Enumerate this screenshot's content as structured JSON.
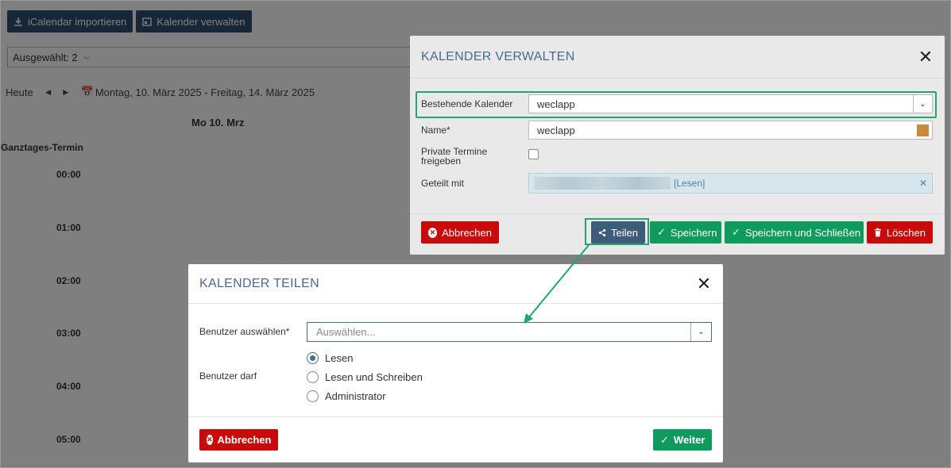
{
  "toolbar": {
    "import_label": "iCalendar importieren",
    "manage_label": "Kalender verwalten"
  },
  "selection": {
    "label": "Ausgewählt: 2"
  },
  "nav": {
    "today_label": "Heute",
    "date_range": "Montag, 10. März 2025 - Freitag, 14. März 2025"
  },
  "calendar": {
    "day_header": "Mo 10. Mrz",
    "allday_label": "Ganztages-Termin",
    "hours": [
      "00:00",
      "01:00",
      "02:00",
      "03:00",
      "04:00",
      "05:00"
    ]
  },
  "manage_dialog": {
    "title": "KALENDER VERWALTEN",
    "existing_label": "Bestehende Kalender",
    "existing_value": "weclapp",
    "name_label": "Name*",
    "name_value": "weclapp",
    "color": "#c88a3a",
    "private_label_1": "Private Termine",
    "private_label_2": "freigeben",
    "shared_label": "Geteilt mit",
    "shared_permission": "[Lesen]",
    "buttons": {
      "cancel": "Abbrechen",
      "share": "Teilen",
      "save": "Speichern",
      "save_close": "Speichern und Schließen",
      "delete": "Löschen"
    }
  },
  "share_dialog": {
    "title": "KALENDER TEILEN",
    "user_label": "Benutzer auswählen*",
    "user_placeholder": "Auswählen...",
    "permission_label": "Benutzer darf",
    "options": [
      {
        "label": "Lesen",
        "selected": true
      },
      {
        "label": "Lesen und Schreiben",
        "selected": false
      },
      {
        "label": "Administrator",
        "selected": false
      }
    ],
    "buttons": {
      "cancel": "Abbrechen",
      "next": "Weiter"
    }
  },
  "colors": {
    "highlight": "#1fa671",
    "danger": "#c90a0a",
    "success": "#0f9a5e",
    "primary": "#3e5b7a",
    "title": "#4a6a8f"
  }
}
